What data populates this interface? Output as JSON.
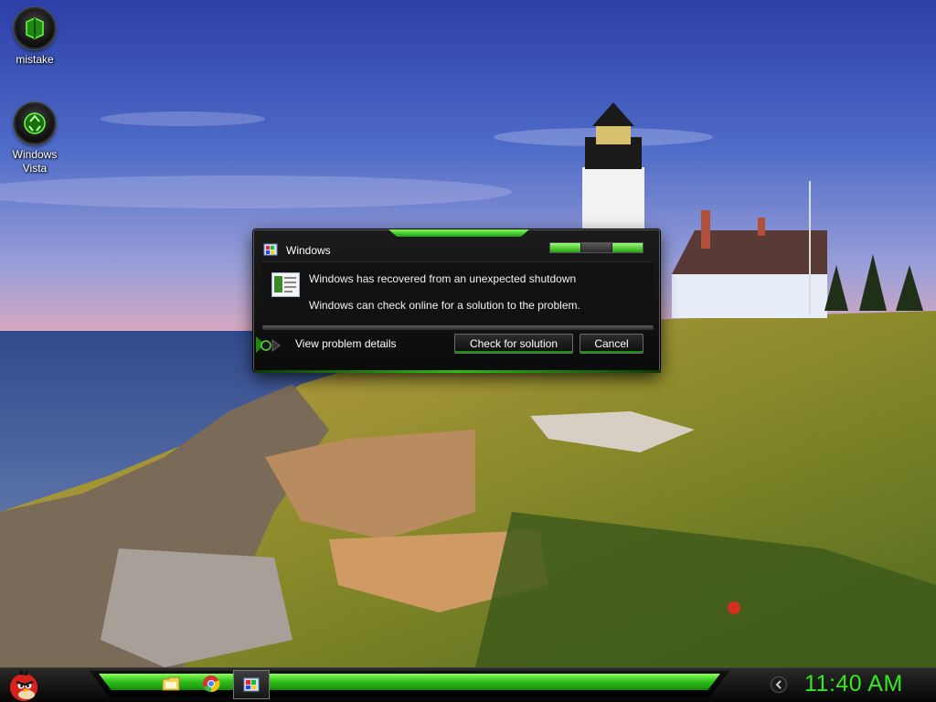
{
  "desktop": {
    "icons": [
      {
        "label": "mistake",
        "icon": "green-cube-orb-icon"
      },
      {
        "label": "Windows Vista",
        "icon": "recycle-bin-orb-icon"
      }
    ]
  },
  "dialog": {
    "title": "Windows",
    "message_heading": "Windows has recovered from an unexpected shutdown",
    "message_body": "Windows can check online for a solution to the problem.",
    "details_label": "View problem details",
    "check_button": "Check for solution",
    "cancel_button": "Cancel"
  },
  "taskbar": {
    "start_icon": "angry-bird-icon",
    "pinned": [
      "folder-icon",
      "chrome-icon",
      "dialog-window-icon"
    ],
    "clock": "11:40 AM"
  },
  "theme": {
    "accent_green": "#36e61e",
    "dialog_bg": "#111111"
  }
}
